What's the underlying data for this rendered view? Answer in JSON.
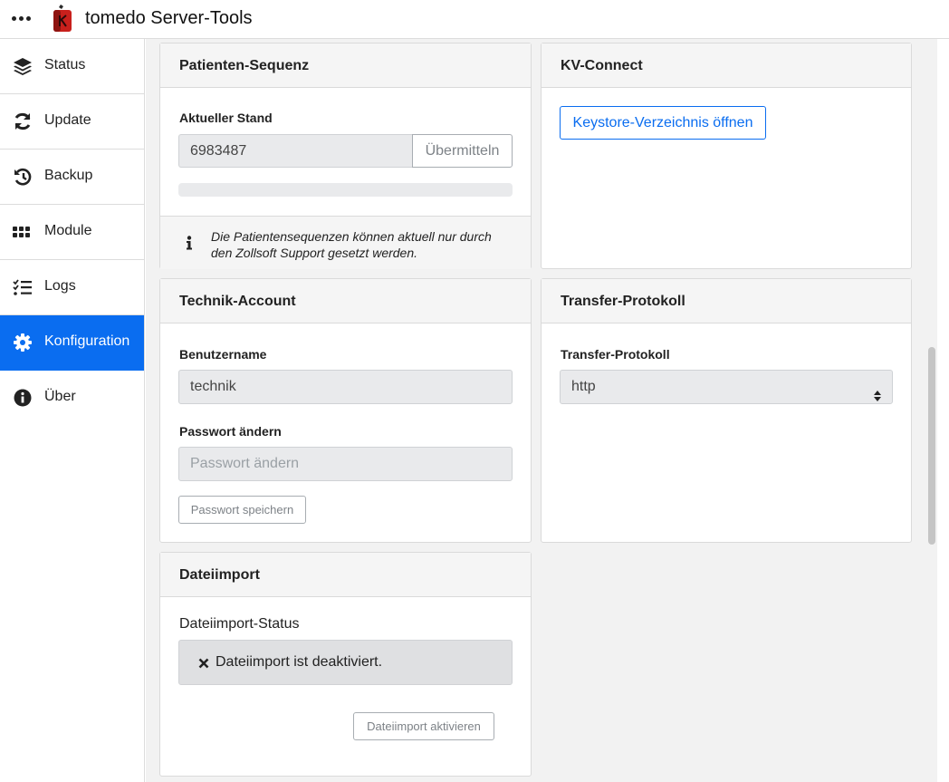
{
  "app": {
    "title": "tomedo Server-Tools",
    "accent_color": "#0a6df0",
    "logo_icon": "tomedo-logo-icon"
  },
  "sidebar": {
    "items": [
      {
        "label": "Status",
        "icon": "layers-icon",
        "active": false
      },
      {
        "label": "Update",
        "icon": "refresh-icon",
        "active": false
      },
      {
        "label": "Backup",
        "icon": "history-icon",
        "active": false
      },
      {
        "label": "Module",
        "icon": "grid-icon",
        "active": false
      },
      {
        "label": "Logs",
        "icon": "tasks-icon",
        "active": false
      },
      {
        "label": "Konfiguration",
        "icon": "gear-icon",
        "active": true
      },
      {
        "label": "Über",
        "icon": "info-icon",
        "active": false
      }
    ]
  },
  "patienten": {
    "title": "Patienten-Sequenz",
    "label": "Aktueller Stand",
    "value": "6983487",
    "submit_label": "Übermitteln",
    "progress": 0,
    "info_text_line1": "Die Patientensequenzen können aktuell nur durch",
    "info_text_line2": "den Zollsoft Support gesetzt werden."
  },
  "kv": {
    "title": "KV-Connect",
    "button_label": "Keystore-Verzeichnis öffnen"
  },
  "technik": {
    "title": "Technik-Account",
    "user_label": "Benutzername",
    "user_value": "technik",
    "pw_label": "Passwort ändern",
    "pw_placeholder": "Passwort ändern",
    "save_label": "Passwort speichern"
  },
  "transfer": {
    "title": "Transfer-Protokoll",
    "label": "Transfer-Protokoll",
    "selected": "http"
  },
  "dateiimport": {
    "title": "Dateiimport",
    "status_label": "Dateiimport-Status",
    "status_text": "Dateiimport ist deaktiviert.",
    "activate_label": "Dateiimport aktivieren"
  }
}
